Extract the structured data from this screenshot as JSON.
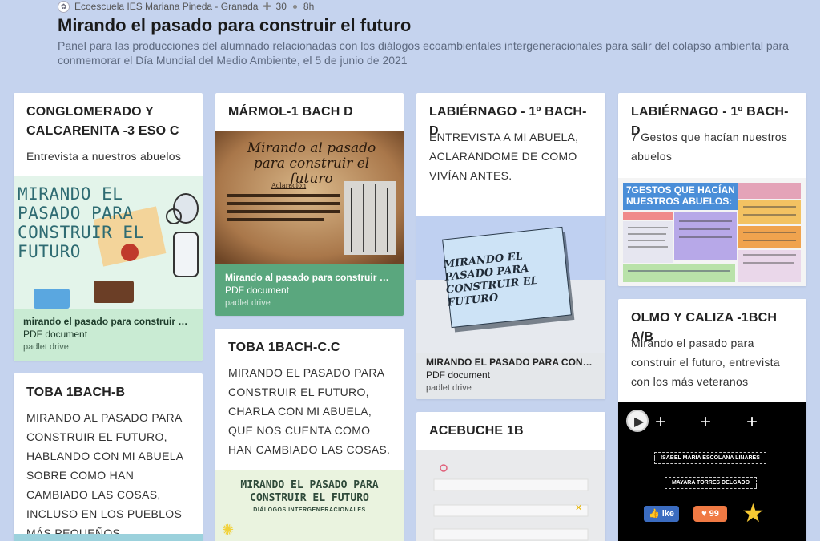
{
  "header": {
    "author": "Ecoescuela IES Mariana Pineda - Granada",
    "likes": "30",
    "time": "8h",
    "title": "Mirando el pasado para construir el futuro",
    "description": "Panel para las producciones del alumnado relacionadas con los diálogos ecoambientales intergeneracionales para salir del colapso ambiental para conmemorar el Día Mundial del Medio Ambiente, el 5 de junio de 2021"
  },
  "colors": {
    "background": "#c5d3ee",
    "green_attach": "#5aa77e",
    "light_green_attach": "#c9ebd3",
    "grey_attach": "#e4e7ea"
  },
  "cards": {
    "c1": {
      "title": "CONGLOMERADO Y CALCARENITA -3 ESO C",
      "body": "Entrevista a nuestros abuelos",
      "thumb_text": "MIRANDO EL PASADO PARA CONSTRUIR EL FUTURO",
      "att_title": "mirando el pasado para construir el f…",
      "att_type": "PDF document",
      "att_src": "padlet drive"
    },
    "c2": {
      "title": "TOBA 1BACH-B",
      "body": "MIRANDO AL PASADO PARA CONSTRUIR EL FUTURO, HABLANDO CON MI ABUELA SOBRE COMO HAN CAMBIADO LAS COSAS, INCLUSO EN LOS PUEBLOS MÁS PEQUEÑOS."
    },
    "c3": {
      "title": "MÁRMOL-1 BACH D",
      "thumb_title": "Mirando al pasado para construir el futuro",
      "thumb_sub": "Aclaración",
      "att_title": "Mirando al pasado para construir el f…",
      "att_type": "PDF document",
      "att_src": "padlet drive"
    },
    "c4": {
      "title": "TOBA 1BACH-C.C",
      "body": "MIRANDO EL PASADO PARA CONSTRUIR EL FUTURO, CHARLA CON MI ABUELA, QUE NOS CUENTA COMO HAN CAMBIADO LAS COSAS.",
      "thumb_title": "MIRANDO EL PASADO PARA CONSTRUIR EL FUTURO",
      "thumb_sub": "DIÁLOGOS INTERGENERACIONALES"
    },
    "c5": {
      "title": "LABIÉRNAGO - 1º BACH-D",
      "body": "ENTREVISTA A MI ABUELA, ACLARANDOME DE COMO VIVÍAN ANTES.",
      "thumb_text": "MIRANDO EL PASADO PARA CONSTRUIR EL FUTURO",
      "att_title": "MIRANDO EL PASADO PARA CONST…",
      "att_type": "PDF document",
      "att_src": "padlet drive"
    },
    "c6": {
      "title": "ACEBUCHE 1B"
    },
    "c7": {
      "title": "LABIÉRNAGO - 1º BACH-D",
      "body": "7 Gestos que hacían nuestros abuelos",
      "thumb_head": "7GESTOS QUE HACÍAN NUESTROS ABUELOS:"
    },
    "c8": {
      "title": "OLMO Y CALIZA -1BCH A/B",
      "body": "Mirando el pasado para construir el futuro, entrevista con los más veteranos",
      "thumb_name1": "ISABEL MARIA ESCOLANA LINARES",
      "thumb_name2": "MAYARA TORRES DELGADO",
      "thumb_badge": "99"
    }
  }
}
